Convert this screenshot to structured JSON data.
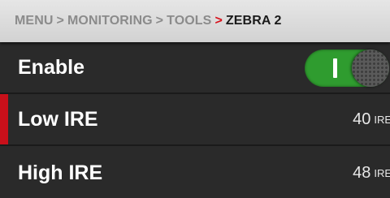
{
  "breadcrumb": {
    "items": [
      "MENU",
      "MONITORING",
      "TOOLS"
    ],
    "separator": ">",
    "current": "ZEBRA 2"
  },
  "rows": [
    {
      "label": "Enable",
      "control": "toggle",
      "state": "on"
    },
    {
      "label": "Low IRE",
      "value": "40",
      "unit": "IRE",
      "selected": true
    },
    {
      "label": "High IRE",
      "value": "48",
      "unit": "IRE"
    }
  ],
  "colors": {
    "accent": "#c8101a",
    "toggle_on": "#2f9c2f",
    "background": "#2a2a2a",
    "breadcrumb_bg": "#dcdcdc"
  }
}
